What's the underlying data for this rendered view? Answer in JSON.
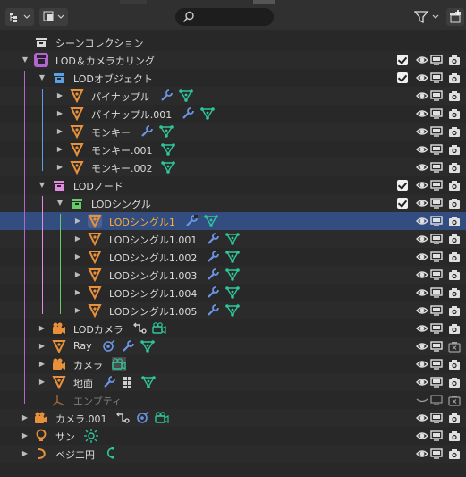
{
  "header": {
    "display_mode_icon": "outliner-display-mode-icon",
    "filter_icon": "funnel-icon",
    "new_collection_icon": "new-collection-icon",
    "search": {
      "value": "",
      "placeholder": ""
    }
  },
  "colors": {
    "selected_row": "#334d80",
    "highlight_text": "#ffaf29",
    "collection_white": "#d9d9d9",
    "collection_purple": "#b366cc",
    "collection_blue": "#5aa0e6",
    "collection_pink": "#e08ce0",
    "collection_green": "#66cc66",
    "object_orange": "#e8913a",
    "modifier_blue": "#6b96e6",
    "data_green": "#2ec79a"
  },
  "tree": [
    {
      "label": "シーンコレクション",
      "depth": 0,
      "expand": "none",
      "icon": "scene-collection-icon",
      "mods": [],
      "check": false,
      "eye": false
    },
    {
      "label": "LOD＆カメラカリング",
      "depth": 0,
      "expand": "open",
      "icon": "collection-purple-icon",
      "mods": [],
      "check": true,
      "eye": true,
      "cam": "camera"
    },
    {
      "label": "LODオブジェクト",
      "depth": 1,
      "expand": "open",
      "icon": "collection-blue-icon",
      "mods": [],
      "check": true,
      "eye": true,
      "cam": "camera"
    },
    {
      "label": "パイナップル",
      "depth": 2,
      "expand": "closed",
      "icon": "mesh-object-icon",
      "mods": [
        "wrench-icon",
        "mesh-data-icon"
      ],
      "eye": true,
      "cam": "camera"
    },
    {
      "label": "パイナップル.001",
      "depth": 2,
      "expand": "closed",
      "icon": "mesh-object-icon",
      "mods": [
        "wrench-icon",
        "mesh-data-icon"
      ],
      "eye": true,
      "cam": "camera"
    },
    {
      "label": "モンキー",
      "depth": 2,
      "expand": "closed",
      "icon": "mesh-object-icon",
      "mods": [
        "wrench-icon",
        "mesh-data-icon"
      ],
      "eye": true,
      "cam": "camera"
    },
    {
      "label": "モンキー.001",
      "depth": 2,
      "expand": "closed",
      "icon": "mesh-object-icon",
      "mods": [
        "mesh-data-icon"
      ],
      "eye": true,
      "cam": "camera"
    },
    {
      "label": "モンキー.002",
      "depth": 2,
      "expand": "closed",
      "icon": "mesh-object-icon",
      "mods": [
        "mesh-data-icon"
      ],
      "eye": true,
      "cam": "camera"
    },
    {
      "label": "LODノード",
      "depth": 1,
      "expand": "open",
      "icon": "collection-pink-icon",
      "mods": [],
      "check": true,
      "eye": true,
      "cam": "camera"
    },
    {
      "label": "LODシングル",
      "depth": 2,
      "expand": "open",
      "icon": "collection-green-icon",
      "mods": [],
      "check": true,
      "eye": true,
      "cam": "camera"
    },
    {
      "label": "LODシングル1",
      "depth": 3,
      "expand": "closed",
      "icon": "mesh-object-icon",
      "mods": [
        "wrench-icon",
        "mesh-data-icon"
      ],
      "eye": true,
      "cam": "camera",
      "selected": true
    },
    {
      "label": "LODシングル1.001",
      "depth": 3,
      "expand": "closed",
      "icon": "mesh-object-icon",
      "mods": [
        "wrench-icon",
        "mesh-data-icon"
      ],
      "eye": true,
      "cam": "camera"
    },
    {
      "label": "LODシングル1.002",
      "depth": 3,
      "expand": "closed",
      "icon": "mesh-object-icon",
      "mods": [
        "wrench-icon",
        "mesh-data-icon"
      ],
      "eye": true,
      "cam": "camera"
    },
    {
      "label": "LODシングル1.003",
      "depth": 3,
      "expand": "closed",
      "icon": "mesh-object-icon",
      "mods": [
        "wrench-icon",
        "mesh-data-icon"
      ],
      "eye": true,
      "cam": "camera"
    },
    {
      "label": "LODシングル1.004",
      "depth": 3,
      "expand": "closed",
      "icon": "mesh-object-icon",
      "mods": [
        "wrench-icon",
        "mesh-data-icon"
      ],
      "eye": true,
      "cam": "camera"
    },
    {
      "label": "LODシングル1.005",
      "depth": 3,
      "expand": "closed",
      "icon": "mesh-object-icon",
      "mods": [
        "wrench-icon",
        "mesh-data-icon"
      ],
      "eye": true,
      "cam": "camera"
    },
    {
      "label": "LODカメラ",
      "depth": 1,
      "expand": "closed",
      "icon": "camera-object-icon",
      "mods": [
        "constraint-icon",
        "camera-data-icon"
      ],
      "eye": true,
      "cam": "camera"
    },
    {
      "label": "Ray",
      "depth": 1,
      "expand": "closed",
      "icon": "mesh-object-icon",
      "mods": [
        "constraint-circle-icon",
        "wrench-icon",
        "mesh-data-icon"
      ],
      "eye": true,
      "cam": "camera-off"
    },
    {
      "label": "カメラ",
      "depth": 1,
      "expand": "closed",
      "icon": "camera-object-icon",
      "mods": [
        "camera-data-active-icon"
      ],
      "eye": true,
      "cam": "camera"
    },
    {
      "label": "地面",
      "depth": 1,
      "expand": "closed",
      "icon": "mesh-object-icon",
      "mods": [
        "wrench-icon",
        "grid-icon",
        "mesh-data-icon"
      ],
      "eye": true,
      "cam": "camera"
    },
    {
      "label": "エンプティ",
      "depth": 1,
      "expand": "none",
      "icon": "empty-object-icon",
      "mods": [],
      "eye": false,
      "hidden": true,
      "cam": "camera-off",
      "dim": true
    },
    {
      "label": "カメラ.001",
      "depth": 0,
      "expand": "closed",
      "icon": "camera-object-icon",
      "mods": [
        "constraint-icon",
        "constraint-circle-icon",
        "camera-data-icon"
      ],
      "eye": true,
      "cam": "camera"
    },
    {
      "label": "サン",
      "depth": 0,
      "expand": "closed",
      "icon": "light-object-icon",
      "mods": [
        "sun-data-icon"
      ],
      "eye": true,
      "cam": "camera"
    },
    {
      "label": "ベジエ円",
      "depth": 0,
      "expand": "closed",
      "icon": "curve-object-icon",
      "mods": [
        "curve-data-icon"
      ],
      "eye": true,
      "cam": "camera"
    }
  ]
}
